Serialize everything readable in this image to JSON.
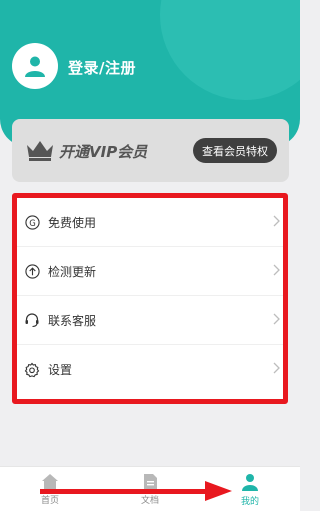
{
  "header": {
    "login_label": "登录/注册",
    "accent_color": "#1fb5a9"
  },
  "vip": {
    "title": "开通VIP会员",
    "button_label": "查看会员特权",
    "icon": "crown-icon"
  },
  "menu": {
    "items": [
      {
        "label": "免费使用",
        "icon": "g-circle-icon"
      },
      {
        "label": "检测更新",
        "icon": "upload-circle-icon"
      },
      {
        "label": "联系客服",
        "icon": "headset-icon"
      },
      {
        "label": "设置",
        "icon": "gear-icon"
      }
    ],
    "highlight_color": "#e8181f"
  },
  "tabbar": {
    "tabs": [
      {
        "label": "首页",
        "icon": "home-icon",
        "active": false
      },
      {
        "label": "文档",
        "icon": "document-icon",
        "active": false
      },
      {
        "label": "我的",
        "icon": "user-icon",
        "active": true
      }
    ]
  }
}
